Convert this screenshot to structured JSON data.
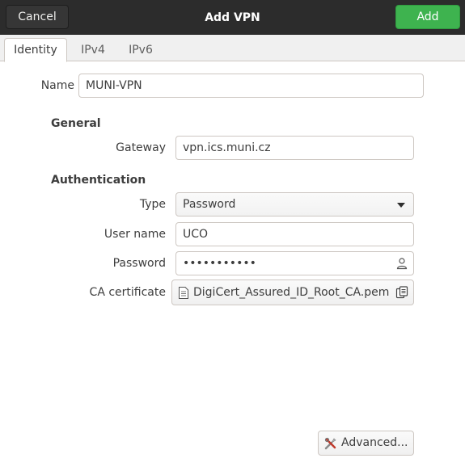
{
  "header": {
    "title": "Add VPN",
    "cancel_label": "Cancel",
    "add_label": "Add"
  },
  "tabs": [
    {
      "label": "Identity",
      "active": true
    },
    {
      "label": "IPv4",
      "active": false
    },
    {
      "label": "IPv6",
      "active": false
    }
  ],
  "identity": {
    "name_label": "Name",
    "name_value": "MUNI-VPN",
    "general_heading": "General",
    "gateway_label": "Gateway",
    "gateway_value": "vpn.ics.muni.cz",
    "auth_heading": "Authentication",
    "type_label": "Type",
    "type_value": "Password",
    "username_label": "User name",
    "username_value": "UCO",
    "password_label": "Password",
    "password_value": "•••••••••••",
    "ca_label": "CA certificate",
    "ca_value": "DigiCert_Assured_ID_Root_CA.pem",
    "advanced_label": "Advanced..."
  },
  "icons": {
    "password_user": "user-icon",
    "file": "document-icon",
    "file_open": "copy-icon",
    "advanced": "tools-icon"
  },
  "colors": {
    "headerbar": "#2c2c2c",
    "add_button": "#3eb34f"
  }
}
